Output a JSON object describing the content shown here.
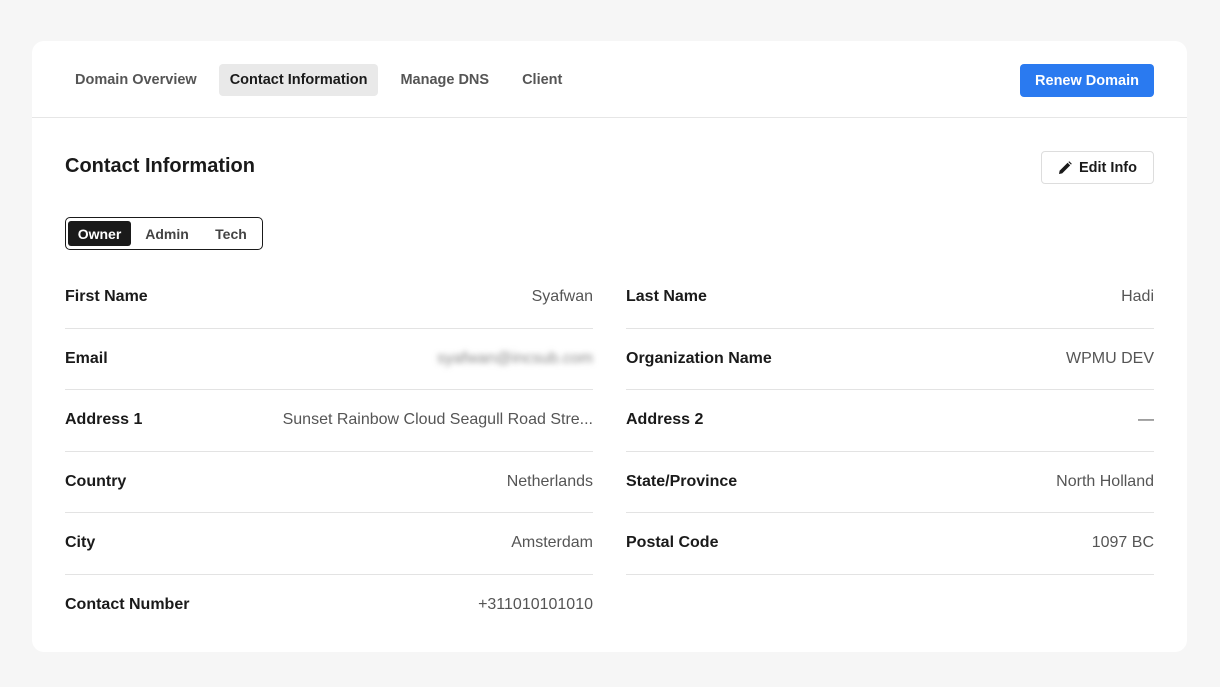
{
  "tabs": [
    {
      "label": "Domain Overview",
      "active": false
    },
    {
      "label": "Contact Information",
      "active": true
    },
    {
      "label": "Manage DNS",
      "active": false
    },
    {
      "label": "Client",
      "active": false
    }
  ],
  "renew_button": "Renew Domain",
  "section_title": "Contact Information",
  "edit_button": {
    "label": "Edit Info",
    "icon": "pencil-icon"
  },
  "contact_types": [
    "Owner",
    "Admin",
    "Tech"
  ],
  "selected_contact_type": "Owner",
  "left_fields": [
    {
      "label": "First Name",
      "value": "Syafwan"
    },
    {
      "label": "Email",
      "value": "syafwan@incsub.com"
    },
    {
      "label": "Address 1",
      "value": "Sunset Rainbow Cloud Seagull Road Stre..."
    },
    {
      "label": "Country",
      "value": "Netherlands"
    },
    {
      "label": "City",
      "value": "Amsterdam"
    },
    {
      "label": "Contact Number",
      "value": "+311010101010"
    }
  ],
  "right_fields": [
    {
      "label": "Last Name",
      "value": "Hadi"
    },
    {
      "label": "Organization Name",
      "value": "WPMU DEV"
    },
    {
      "label": "Address 2",
      "value": "—"
    },
    {
      "label": "State/Province",
      "value": "North Holland"
    },
    {
      "label": "Postal Code",
      "value": "1097 BC"
    }
  ],
  "colors": {
    "accent": "#2a7af0",
    "active_segment": "#1a1a1a",
    "active_tab_bg": "#e9e9e9"
  }
}
